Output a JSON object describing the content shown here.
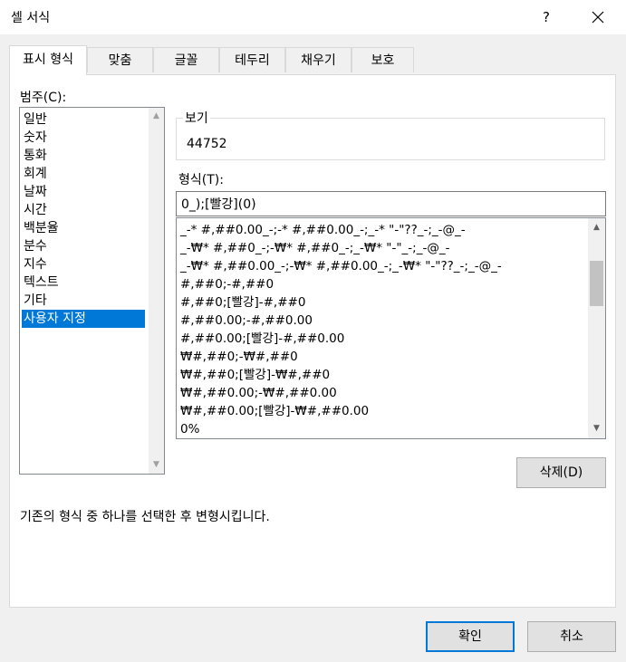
{
  "window": {
    "title": "셀 서식",
    "help": "?"
  },
  "tabs": [
    {
      "label": "표시 형식",
      "active": true
    },
    {
      "label": "맞춤"
    },
    {
      "label": "글꼴"
    },
    {
      "label": "테두리"
    },
    {
      "label": "채우기"
    },
    {
      "label": "보호"
    }
  ],
  "category": {
    "label": "범주(C):",
    "items": [
      "일반",
      "숫자",
      "통화",
      "회계",
      "날짜",
      "시간",
      "백분율",
      "분수",
      "지수",
      "텍스트",
      "기타",
      "사용자 지정"
    ],
    "selected": "사용자 지정"
  },
  "sample": {
    "legend": "보기",
    "value": "44752"
  },
  "format": {
    "label": "형식(T):",
    "value": "0_);[빨강](0)",
    "items": [
      "_-* #,##0.00_-;-* #,##0.00_-;_-* \"-\"??_-;_-@_-",
      "_-₩* #,##0_-;-₩* #,##0_-;_-₩* \"-\"_-;_-@_-",
      "_-₩* #,##0.00_-;-₩* #,##0.00_-;_-₩* \"-\"??_-;_-@_-",
      "#,##0;-#,##0",
      "#,##0;[빨강]-#,##0",
      "#,##0.00;-#,##0.00",
      "#,##0.00;[빨강]-#,##0.00",
      "₩#,##0;-₩#,##0",
      "₩#,##0;[빨강]-₩#,##0",
      "₩#,##0.00;-₩#,##0.00",
      "₩#,##0.00;[빨강]-₩#,##0.00",
      "0%"
    ]
  },
  "delete_button": "삭제(D)",
  "description": "기존의 형식 중 하나를 선택한 후 변형시킵니다.",
  "ok_button": "확인",
  "cancel_button": "취소",
  "colors": {
    "accent": "#0078d7",
    "selection": "#0078d7"
  }
}
